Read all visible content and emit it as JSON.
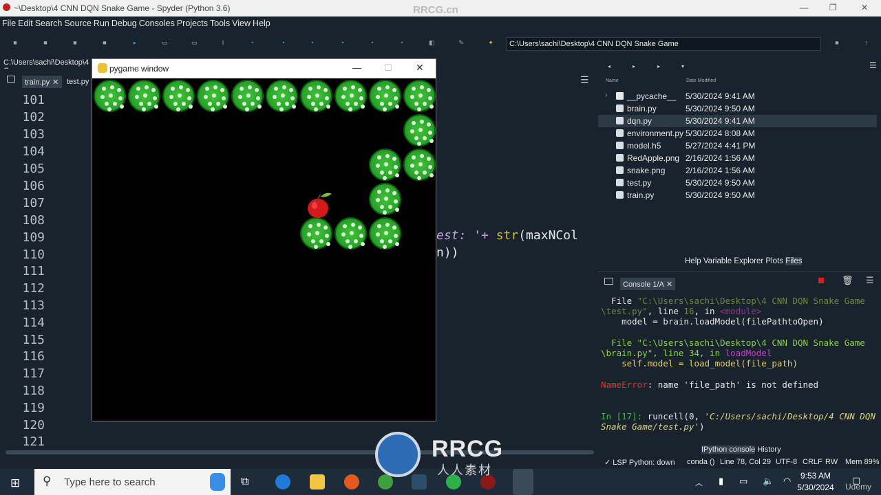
{
  "window": {
    "title": "~\\Desktop\\4 CNN DQN Snake Game - Spyder (Python 3.6)",
    "brand": "RRCG.cn"
  },
  "menu": [
    "File",
    "Edit",
    "Search",
    "Source",
    "Run",
    "Debug",
    "Consoles",
    "Projects",
    "Tools",
    "View",
    "Help"
  ],
  "toolbar": {
    "path": "C:\\Users\\sachi\\Desktop\\4 CNN DQN Snake Game"
  },
  "editor": {
    "cwd": "C:\\Users\\sachi\\Desktop\\4 C",
    "tabs": [
      "train.py",
      "test.py"
    ],
    "lines": [
      "101",
      "102",
      "103",
      "104",
      "105",
      "106",
      "107",
      "108",
      "109",
      "110",
      "111",
      "112",
      "113",
      "114",
      "115",
      "116",
      "117",
      "118",
      "119",
      "120",
      "121"
    ],
    "code109a": "est: ",
    "code109b": "'+ ",
    "code109c": "str",
    "code109d": "(maxNCol",
    "code110": "n))"
  },
  "pygame": {
    "title": "pygame window"
  },
  "files": {
    "header_name": "Name",
    "header_date": "Date Modified",
    "rows": [
      {
        "name": "__pycache__",
        "date": "5/30/2024 9:41 AM",
        "type": "folder"
      },
      {
        "name": "brain.py",
        "date": "5/30/2024 9:50 AM",
        "type": "py"
      },
      {
        "name": "dqn.py",
        "date": "5/30/2024 9:41 AM",
        "type": "py"
      },
      {
        "name": "environment.py",
        "date": "5/30/2024 8:08 AM",
        "type": "py"
      },
      {
        "name": "model.h5",
        "date": "5/27/2024 4:41 PM",
        "type": "file"
      },
      {
        "name": "RedApple.png",
        "date": "2/16/2024 1:56 AM",
        "type": "file"
      },
      {
        "name": "snake.png",
        "date": "2/16/2024 1:56 AM",
        "type": "file"
      },
      {
        "name": "test.py",
        "date": "5/30/2024 9:50 AM",
        "type": "py"
      },
      {
        "name": "train.py",
        "date": "5/30/2024 9:50 AM",
        "type": "py"
      }
    ],
    "pane_tabs": [
      "Help",
      "Variable Explorer",
      "Plots",
      "Files"
    ]
  },
  "console": {
    "tab": "Console 1/A",
    "l1": "  File ",
    "l1p": "\"C:\\Users\\sachi\\Desktop\\4 CNN DQN Snake Game",
    "l2": "\\test.py\"",
    "l2b": ", line ",
    "l2c": "16",
    "l2d": ", in ",
    "l2e": "<module>",
    "l3": "    model = brain.loadModel(filePathtoOpen)",
    "l4": "  File \"C:\\Users\\sachi\\Desktop\\4 CNN DQN Snake Game",
    "l5": "\\brain.py\"",
    "l5b": ", line 34, in ",
    "l5c": "loadModel",
    "l6": "    self.model = load_model(file_path)",
    "l7a": "NameError",
    "l7b": ": name 'file_path' is not defined",
    "l8a": "In [17]: ",
    "l8b": "runcell(0, ",
    "l8c": "'C:/Users/sachi/Desktop/4 CNN DQN",
    "l9": "Snake Game/test.py'",
    "l9b": ")",
    "tabs": [
      "IPython console",
      "History"
    ]
  },
  "status": {
    "lsp": "LSP Python: down",
    "env": "conda ()",
    "pos": "Line 78, Col 29",
    "enc": "UTF-8",
    "eol": "CRLF",
    "rw": "RW",
    "mem": "Mem 89%"
  },
  "taskbar": {
    "search": "Type here to search",
    "time": "9:53 AM",
    "date": "5/30/2024"
  },
  "watermark": {
    "a": "RRCG",
    "b": "人人素材",
    "corner": "Udemy"
  }
}
